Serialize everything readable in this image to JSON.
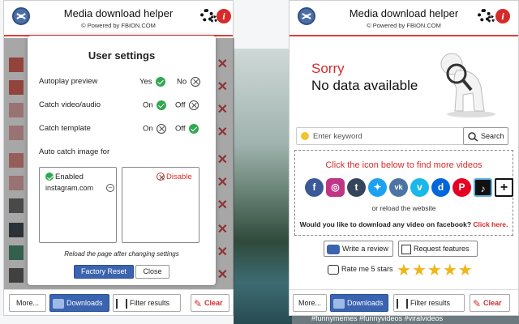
{
  "app": {
    "title": "Media download helper",
    "subtitle": "© Powered by FBION.COM"
  },
  "colors": {
    "accent_red": "#d62b2b",
    "brand_blue": "#3b64b0",
    "check_green": "#2fa84f",
    "star": "#f0b518"
  },
  "background": {
    "bottom_text": "#funnymemes #funnyvideos #viralvideos"
  },
  "settings_dialog": {
    "title": "User settings",
    "rows": [
      {
        "label": "Autoplay preview",
        "on_label": "Yes",
        "off_label": "No",
        "selected": "on"
      },
      {
        "label": "Catch video/audio",
        "on_label": "On",
        "off_label": "Off",
        "selected": "on"
      },
      {
        "label": "Catch template",
        "on_label": "On",
        "off_label": "Off",
        "selected": "off"
      }
    ],
    "auto_catch_label": "Auto catch image for",
    "enabled_label": "Enabled",
    "enabled_sites": [
      "instagram.com"
    ],
    "disable_label": "Disable",
    "reload_note": "Reload the page after changing settings",
    "factory_reset": "Factory Reset",
    "close": "Close"
  },
  "footer": {
    "more": "More...",
    "downloads": "Downloads",
    "filter": "Filter results",
    "clear": "Clear"
  },
  "empty_state": {
    "line1": "Sorry",
    "line2": "No data available"
  },
  "search": {
    "placeholder": "Enter keyword",
    "button": "Search"
  },
  "sites_box": {
    "heading": "Click the icon below to find more videos",
    "icons": [
      "facebook-icon",
      "instagram-icon",
      "tumblr-icon",
      "twitter-icon",
      "vk-icon",
      "vimeo-icon",
      "dailymotion-icon",
      "pinterest-icon",
      "tiktok-icon",
      "add-site-icon"
    ],
    "reload": "or reload the website",
    "fb_question": "Would you like to download any video on facebook?",
    "fb_link": "Click here."
  },
  "feedback": {
    "review": "Write a review",
    "request": "Request features",
    "rate": "Rate me 5 stars",
    "stars": 5
  }
}
